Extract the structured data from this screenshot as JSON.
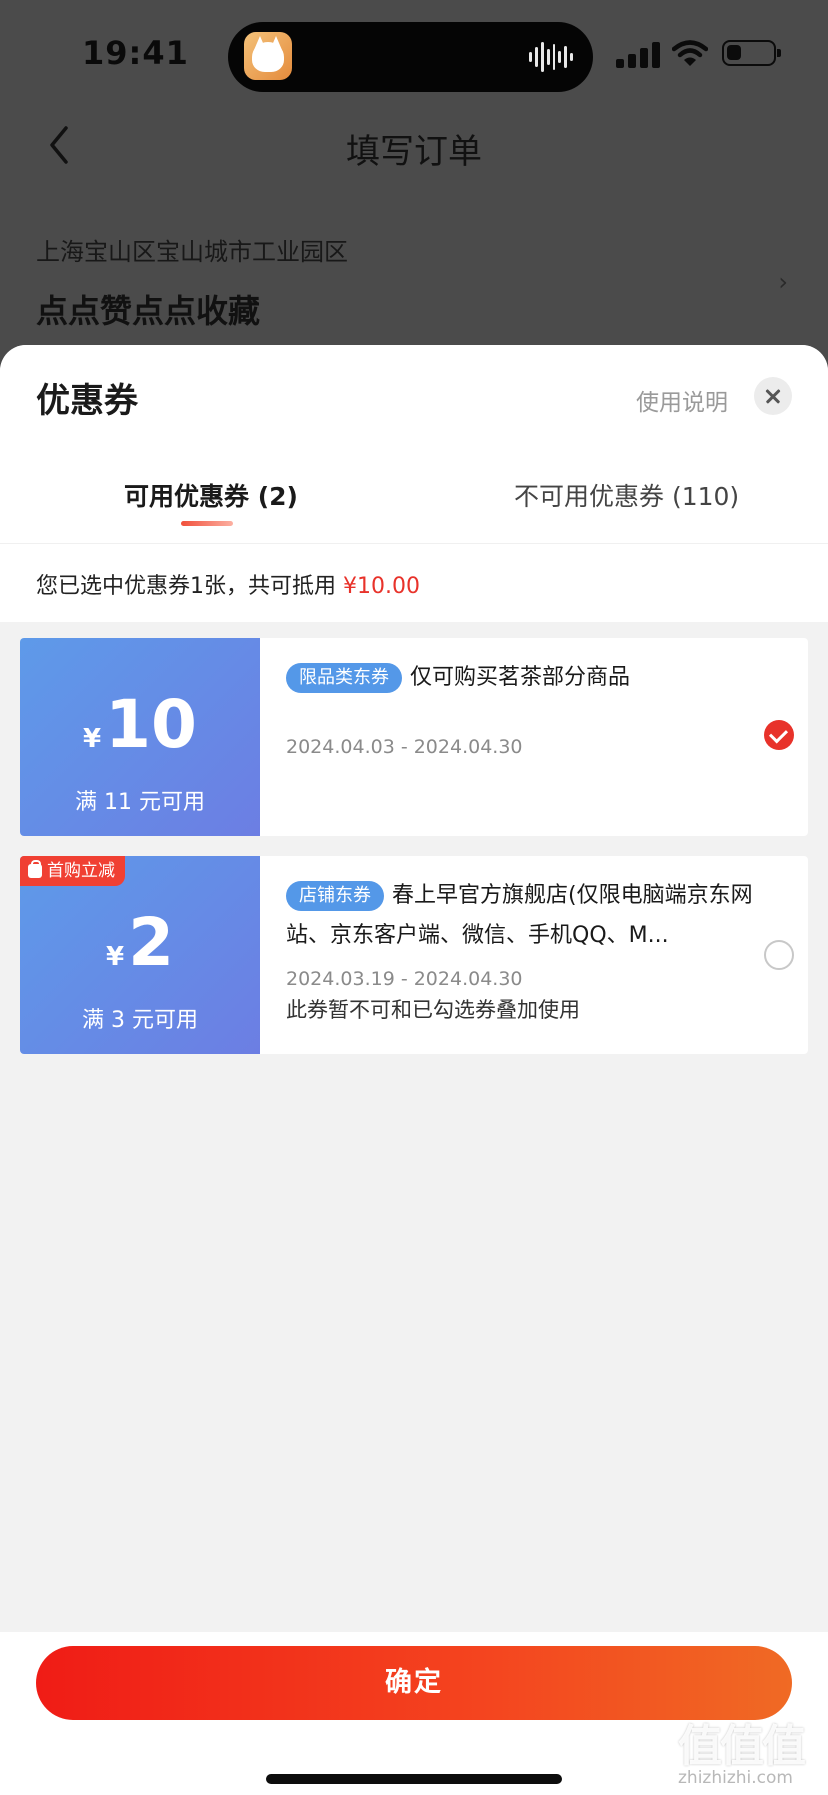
{
  "status_bar": {
    "time": "19:41"
  },
  "nav": {
    "title": "填写订单"
  },
  "address": {
    "line": "上海宝山区宝山城市工业园区",
    "name": "点点赞点点收藏",
    "chevron": "›"
  },
  "sheet": {
    "title": "优惠券",
    "usage_link": "使用说明",
    "tabs": [
      {
        "label": "可用优惠券 (2)",
        "active": true
      },
      {
        "label": "不可用优惠券 (110)",
        "active": false
      }
    ],
    "summary": {
      "text": "您已选中优惠券1张，共可抵用",
      "amount": "¥10.00"
    }
  },
  "coupons": [
    {
      "currency": "¥",
      "amount": "10",
      "threshold": "满 11 元可用",
      "tag": "限品类东券",
      "description": "仅可购买茗茶部分商品",
      "validity": "2024.04.03 - 2024.04.30",
      "selected": true
    },
    {
      "badge": "首购立减",
      "currency": "¥",
      "amount": "2",
      "threshold": "满 3 元可用",
      "tag": "店铺东券",
      "description": "春上早官方旗舰店(仅限电脑端京东网站、京东客户端、微信、手机QQ、M...",
      "validity": "2024.03.19 - 2024.04.30",
      "note": "此券暂不可和已勾选券叠加使用",
      "selected": false
    }
  ],
  "footer": {
    "confirm_label": "确定"
  },
  "watermark": {
    "logo": "值值值",
    "url": "zhizhizhi.com"
  },
  "colors": {
    "accent_red": "#e8322a",
    "coupon_blue": "#5e9ae9",
    "tag_blue": "#5498e8"
  }
}
